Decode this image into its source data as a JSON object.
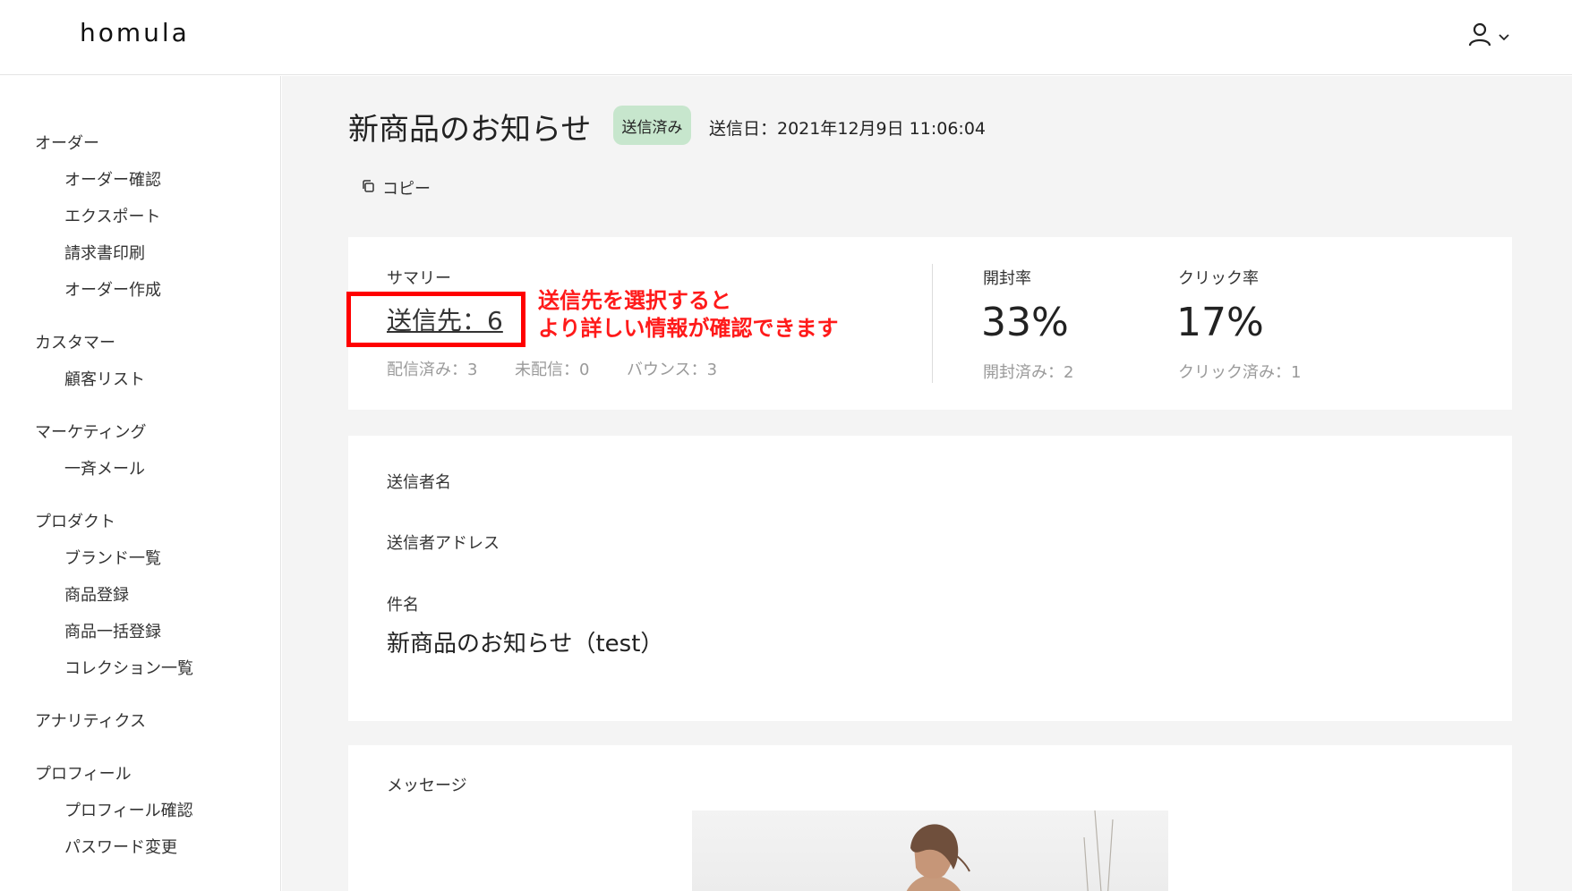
{
  "app": {
    "logo": "homula"
  },
  "header": {
    "user_icon": "user-icon",
    "chevron_icon": "chevron-down-icon"
  },
  "sidebar": {
    "groups": [
      {
        "label": "オーダー",
        "items": [
          "オーダー確認",
          "エクスポート",
          "請求書印刷",
          "オーダー作成"
        ]
      },
      {
        "label": "カスタマー",
        "items": [
          "顧客リスト"
        ]
      },
      {
        "label": "マーケティング",
        "items": [
          "一斉メール"
        ]
      },
      {
        "label": "プロダクト",
        "items": [
          "ブランド一覧",
          "商品登録",
          "商品一括登録",
          "コレクション一覧"
        ]
      },
      {
        "label": "アナリティクス",
        "items": []
      },
      {
        "label": "プロフィール",
        "items": [
          "プロフィール確認",
          "パスワード変更"
        ]
      }
    ]
  },
  "main": {
    "title": "新商品のお知らせ",
    "status": "送信済み",
    "sent_date": "送信日：2021年12月9日 11:06:04",
    "copy_label": "コピー",
    "summary": {
      "label": "サマリー",
      "recipients": "送信先：6",
      "annotation_line1": "送信先を選択すると",
      "annotation_line2": "より詳しい情報が確認できます",
      "delivered": "配信済み：3",
      "undelivered": "未配信：0",
      "bounced": "バウンス：3",
      "open_rate_label": "開封率",
      "open_rate": "33%",
      "opened": "開封済み：2",
      "click_rate_label": "クリック率",
      "click_rate": "17%",
      "clicked": "クリック済み：1"
    },
    "details": {
      "sender_name_label": "送信者名",
      "sender_address_label": "送信者アドレス",
      "subject_label": "件名",
      "subject_value": "新商品のお知らせ（test）"
    },
    "message": {
      "label": "メッセージ"
    }
  },
  "colors": {
    "highlight": "#ff0000",
    "annotation": "#ff1a1a",
    "badge_bg": "#c7e6cd",
    "main_bg": "#f4f4f4"
  }
}
